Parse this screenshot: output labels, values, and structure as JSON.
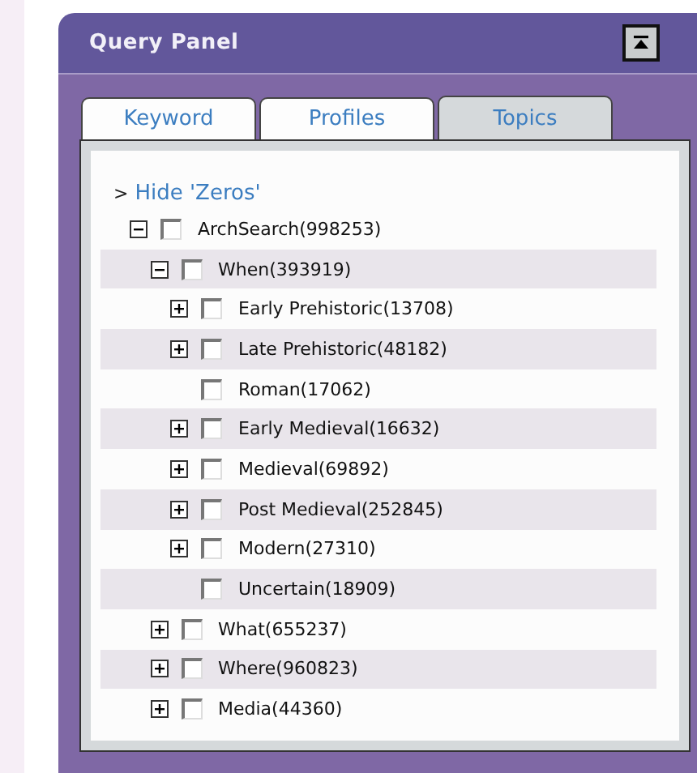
{
  "panel": {
    "title": "Query Panel"
  },
  "tabs": [
    {
      "label": "Keyword",
      "selected": false
    },
    {
      "label": "Profiles",
      "selected": false
    },
    {
      "label": "Topics",
      "selected": true
    }
  ],
  "filter_link": {
    "arrow": ">",
    "label": "Hide 'Zeros'"
  },
  "tree": [
    {
      "label": "ArchSearch(998253)",
      "kind": "branch",
      "expanded": true,
      "checked": false,
      "children": [
        {
          "label": "When(393919)",
          "kind": "branch",
          "expanded": true,
          "checked": false,
          "children": [
            {
              "label": "Early Prehistoric(13708)",
              "kind": "branch",
              "expanded": false,
              "checked": false
            },
            {
              "label": "Late Prehistoric(48182)",
              "kind": "branch",
              "expanded": false,
              "checked": false
            },
            {
              "label": "Roman(17062)",
              "kind": "leaf",
              "checked": false
            },
            {
              "label": "Early Medieval(16632)",
              "kind": "branch",
              "expanded": false,
              "checked": false
            },
            {
              "label": "Medieval(69892)",
              "kind": "branch",
              "expanded": false,
              "checked": false
            },
            {
              "label": "Post Medieval(252845)",
              "kind": "branch",
              "expanded": false,
              "checked": false
            },
            {
              "label": "Modern(27310)",
              "kind": "branch",
              "expanded": false,
              "checked": false
            },
            {
              "label": "Uncertain(18909)",
              "kind": "leaf",
              "checked": false
            }
          ]
        },
        {
          "label": "What(655237)",
          "kind": "branch",
          "expanded": false,
          "checked": false
        },
        {
          "label": "Where(960823)",
          "kind": "branch",
          "expanded": false,
          "checked": false
        },
        {
          "label": "Media(44360)",
          "kind": "branch",
          "expanded": false,
          "checked": false
        }
      ]
    }
  ]
}
